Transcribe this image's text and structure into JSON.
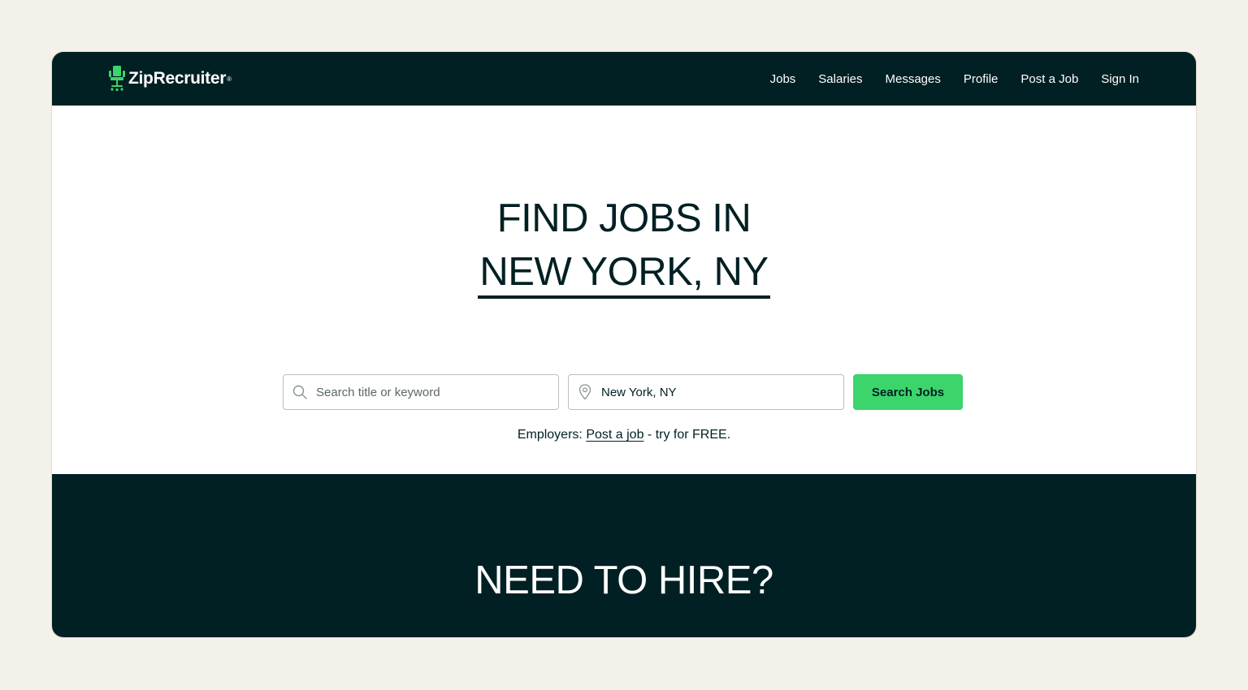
{
  "colors": {
    "page_background": "#f4f1eb",
    "dark_green": "#012023",
    "accent_green": "#3bd56b"
  },
  "header": {
    "logo_text": "ZipRecruiter",
    "logo_reg": "®",
    "logo_icon": "chair-icon",
    "nav": [
      {
        "label": "Jobs"
      },
      {
        "label": "Salaries"
      },
      {
        "label": "Messages"
      },
      {
        "label": "Profile"
      },
      {
        "label": "Post a Job"
      },
      {
        "label": "Sign In"
      }
    ]
  },
  "hero": {
    "title_line1": "FIND JOBS IN",
    "title_location": "NEW YORK, NY",
    "search": {
      "keyword_placeholder": "Search title or keyword",
      "keyword_value": "",
      "location_value": "New York, NY",
      "button_label": "Search Jobs"
    },
    "employers": {
      "prefix": "Employers:",
      "link_label": "Post a job",
      "suffix": "- try for FREE."
    }
  },
  "hire_section": {
    "title": "NEED TO HIRE?"
  }
}
